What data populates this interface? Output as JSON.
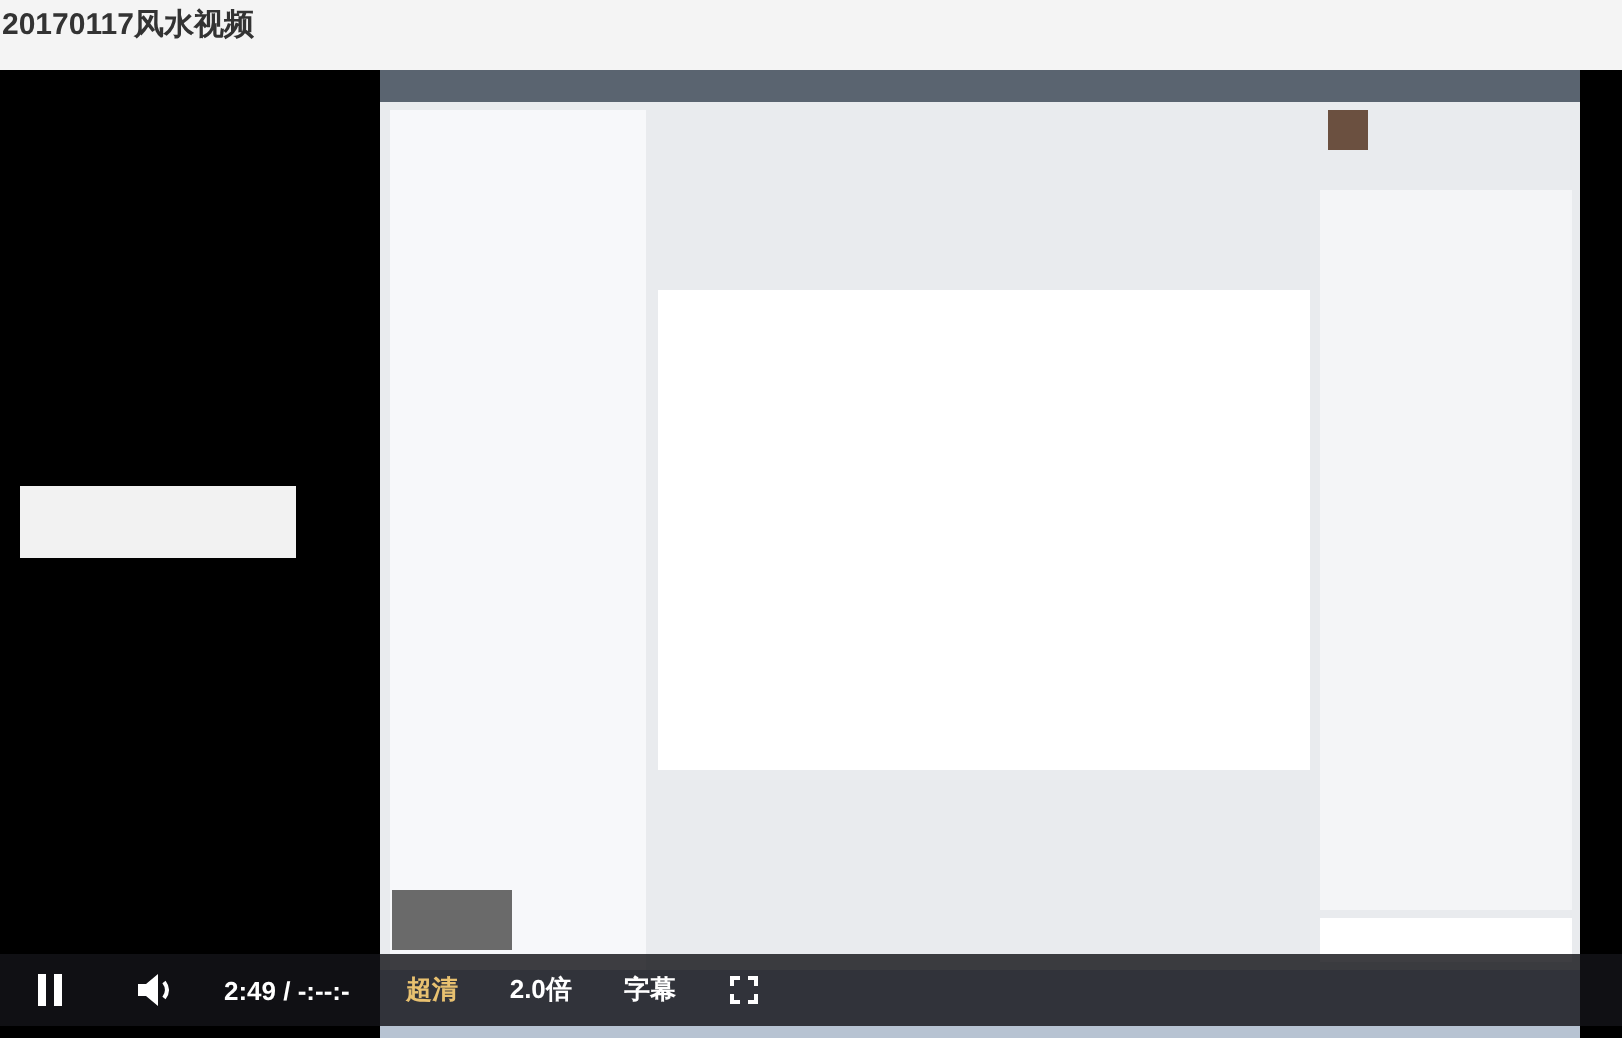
{
  "page": {
    "title": "20170117风水视频"
  },
  "player": {
    "playing": true,
    "time": "2:49 / -:--:-",
    "quality": "超清",
    "speed": "2.0倍",
    "subtitles": "字幕"
  }
}
